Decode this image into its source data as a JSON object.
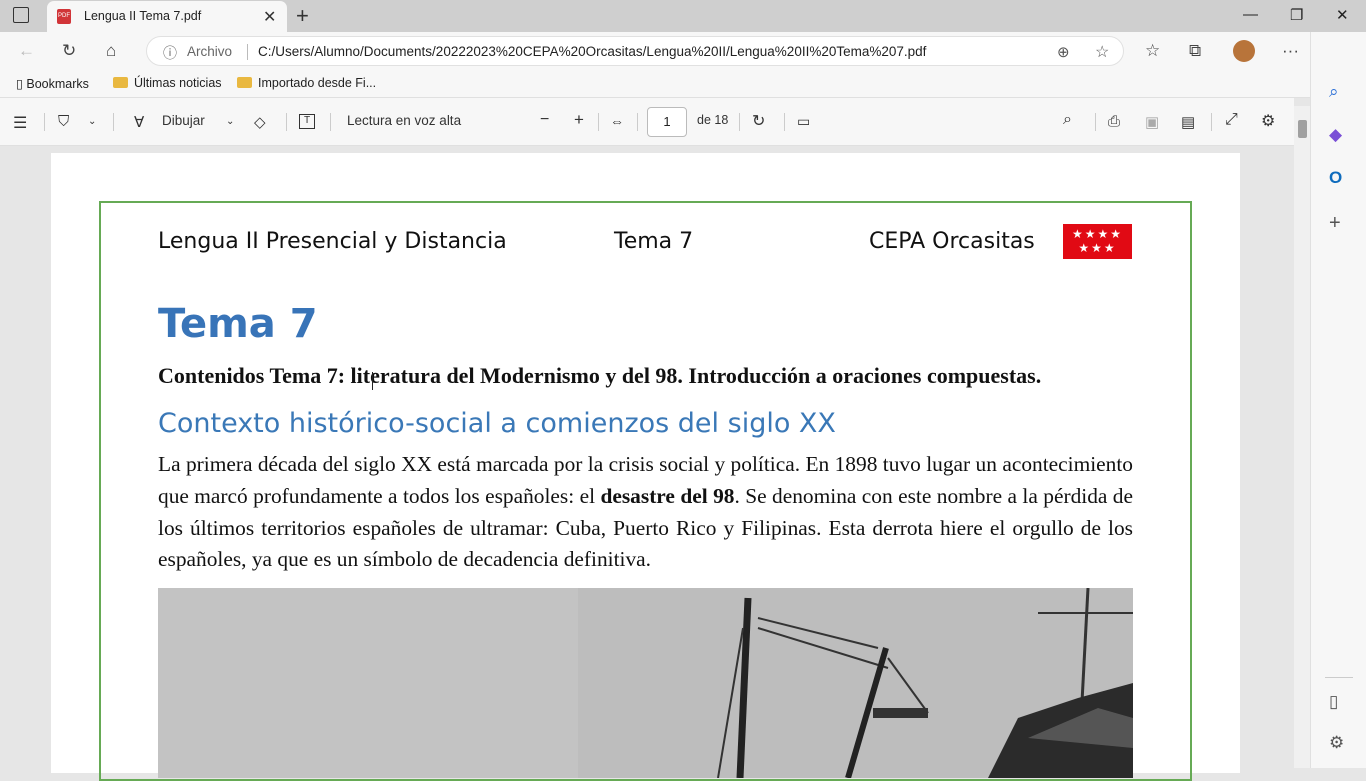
{
  "tab": {
    "title": "Lengua II Tema 7.pdf",
    "icon": "pdf-icon",
    "icon_text": "PDF"
  },
  "address_bar": {
    "scheme_label": "Archivo",
    "url": "C:/Users/Alumno/Documents/20222023%20CEPA%20Orcasitas/Lengua%20II/Lengua%20II%20Tema%207.pdf"
  },
  "bookmarks": {
    "label": "Bookmarks",
    "items": [
      {
        "label": "Últimas noticias"
      },
      {
        "label": "Importado desde Fi..."
      }
    ]
  },
  "pdf_toolbar": {
    "draw_label": "Dibujar",
    "read_aloud_label": "Lectura en voz alta",
    "page_current": "1",
    "page_total": "de 18"
  },
  "document": {
    "header_left": "Lengua II Presencial y Distancia",
    "header_center": "Tema 7",
    "header_right": "CEPA Orcasitas",
    "flag_stars": "★★★★\n★★★",
    "title": "Tema 7",
    "contents": "Contenidos Tema 7: literatura del Modernismo y del 98. Introducción a oraciones compuestas.",
    "section_heading": "Contexto histórico-social a comienzos del siglo XX",
    "paragraph_before": "La primera década del siglo XX está marcada por la crisis social y política. En 1898 tuvo lugar un acontecimiento que marcó profundamente a todos los españoles: el ",
    "paragraph_bold": "desastre del 98",
    "paragraph_after": ". Se denomina con este nombre a la pérdida de los últimos territorios españoles de ultramar: Cuba, Puerto Rico y Filipinas. Esta derrota hiere el orgullo de los españoles, ya que es un símbolo de decadencia definitiva."
  },
  "colors": {
    "accent_blue": "#3874b8",
    "frame_green": "#66aa55",
    "flag_red": "#e10a14"
  }
}
